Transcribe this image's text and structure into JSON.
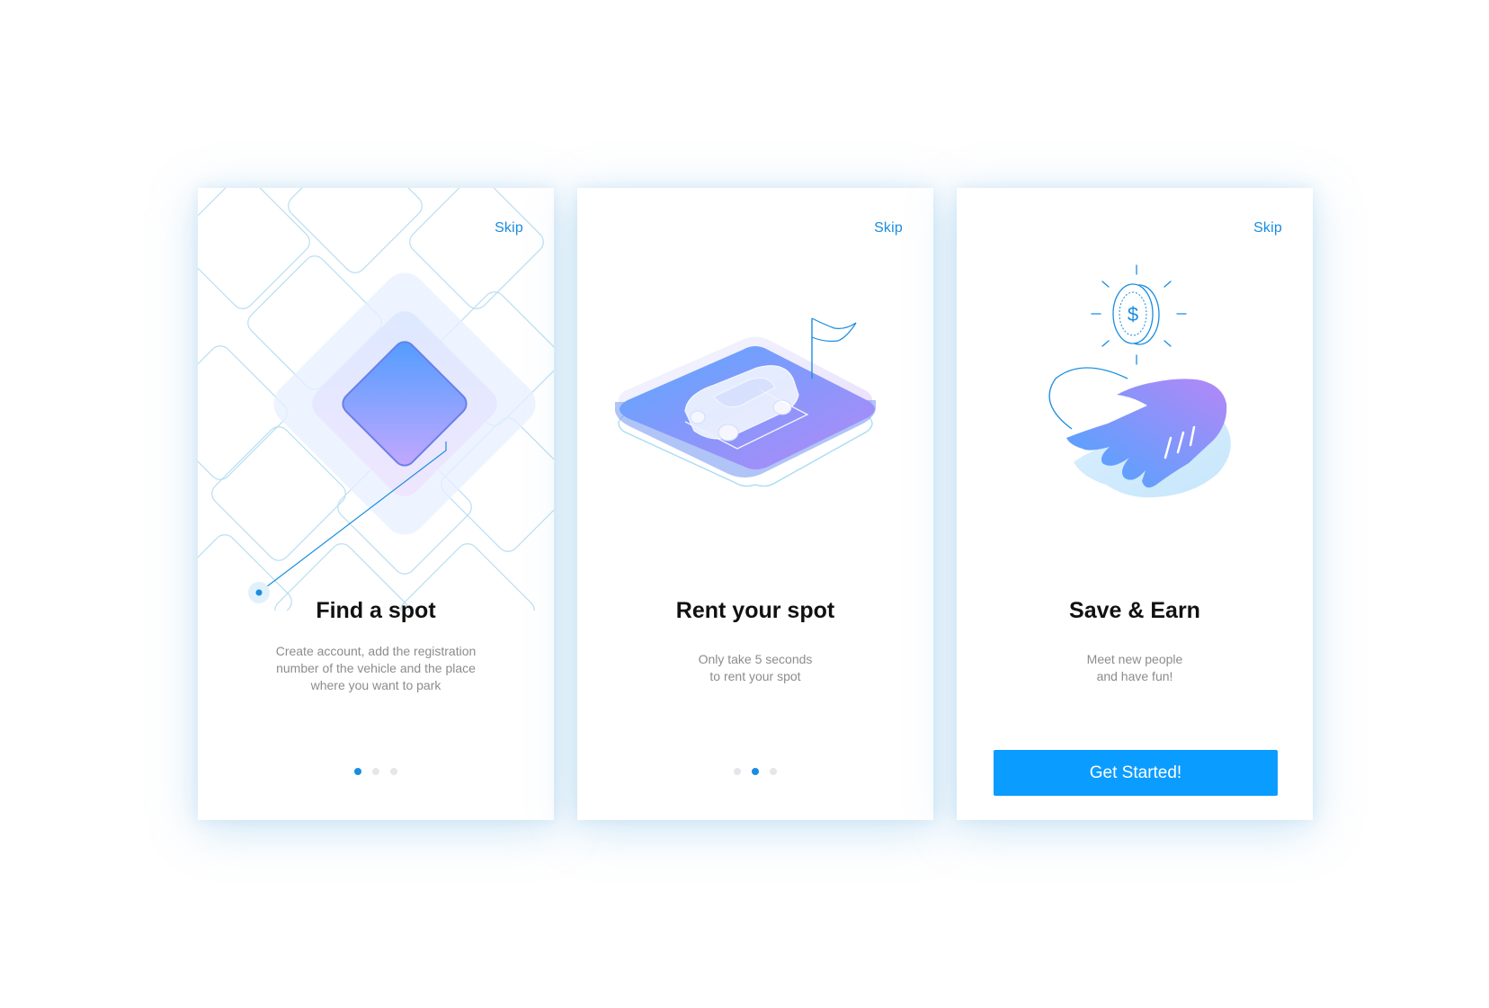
{
  "colors": {
    "accent": "#1a8de0",
    "button": "#0b9cff",
    "dot_inactive": "#e4e6ea",
    "title": "#111111",
    "description": "#8c8c8c"
  },
  "screens": [
    {
      "skip_label": "Skip",
      "illustration_icon": "map-grid-icon",
      "title": "Find a spot",
      "description_lines": [
        "Create account, add the registration",
        "number of the vehicle and the place",
        "where you want to park"
      ],
      "page_indicator": {
        "total": 3,
        "active": 1
      }
    },
    {
      "skip_label": "Skip",
      "illustration_icon": "car-parking-spot-icon",
      "title": "Rent your spot",
      "description_lines": [
        "Only take 5 seconds",
        "to rent your spot"
      ],
      "page_indicator": {
        "total": 3,
        "active": 2
      }
    },
    {
      "skip_label": "Skip",
      "illustration_icon": "handshake-coin-icon",
      "title": "Save & Earn",
      "description_lines": [
        "Meet new people",
        "and have fun!"
      ],
      "cta_label": "Get Started!"
    }
  ]
}
